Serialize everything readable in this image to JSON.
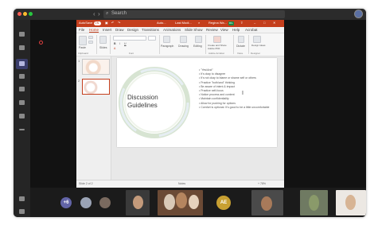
{
  "window": {
    "search_placeholder": "Search",
    "back_arrow": "‹",
    "forward_arrow": "›"
  },
  "powerpoint": {
    "titlebar": {
      "autosave_label": "AutoSave",
      "autosave_state": "ON",
      "file_name": "Auto...",
      "saved_state": "Last Modi...",
      "user_name": "Regina Wa...",
      "coauthor_initials": "RG"
    },
    "tabs": [
      "File",
      "Home",
      "Insert",
      "Draw",
      "Design",
      "Transitions",
      "Animations",
      "Slide Show",
      "Review",
      "View",
      "Help",
      "Acrobat"
    ],
    "active_tab": "Home",
    "ribbon_buttons": [
      "Paste",
      "Slides",
      "Paragraph",
      "Drawing",
      "Editing",
      "Create and Share Adobe PDF",
      "Dictate",
      "Design Ideas"
    ],
    "ribbon_groups": [
      "Clipboard",
      "Font",
      "Adobe Acrobat",
      "Voice",
      "Designer"
    ],
    "thumbnail_numbers": [
      "1",
      "2"
    ],
    "slide": {
      "title": "Discussion Guidelines",
      "bullets": [
        "\"Yes/And\"",
        "It's okay to disagree",
        "It's not okay to blame or shame self or others",
        "Practice \"both/and\" thinking",
        "Be aware of intent & impact",
        "Practice self-focus",
        "Notice process and content",
        "Maintain confidentiality",
        "Allow for pushing for options",
        "Comfort is optional. It's good to be a little uncomfortable"
      ]
    },
    "status": {
      "slide_counter": "Slide 2 of 2",
      "notes": "Notes",
      "zoom": "+ 78%"
    }
  },
  "participants": [
    {
      "initials": "+6",
      "color": "#6264a7"
    },
    {
      "initials": "",
      "color": "#9aa3b5"
    },
    {
      "initials": "",
      "color": "#7a6a5f"
    },
    {
      "initials": "",
      "color": "#c39a7b"
    },
    {
      "initials": "",
      "color": "#b5855f"
    },
    {
      "initials": "AE",
      "color": "#c8a032"
    },
    {
      "initials": "",
      "color": "#a87a5a"
    },
    {
      "initials": "",
      "color": "#8a9a6a"
    },
    {
      "initials": "",
      "color": "#d7b494"
    }
  ]
}
